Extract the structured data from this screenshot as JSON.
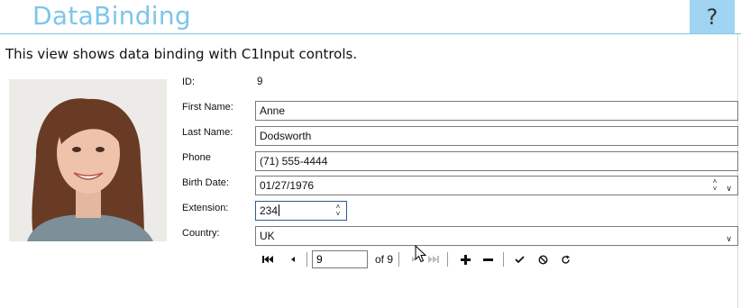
{
  "header": {
    "title": "DataBinding",
    "help_label": "?"
  },
  "description": "This view shows data binding with C1Input controls.",
  "form": {
    "id_label": "ID:",
    "id_value": "9",
    "first_name_label": "First Name:",
    "first_name_value": "Anne",
    "last_name_label": "Last Name:",
    "last_name_value": "Dodsworth",
    "phone_label": "Phone",
    "phone_value": "(71) 555-4444",
    "birth_date_label": "Birth Date:",
    "birth_date_value": "01/27/1976",
    "extension_label": "Extension:",
    "extension_value": "234",
    "country_label": "Country:",
    "country_value": "UK"
  },
  "navigator": {
    "current_page": "9",
    "total_label": "of 9"
  },
  "icons": {
    "first": "first-record-icon",
    "prev": "previous-record-icon",
    "next": "next-record-icon",
    "last": "last-record-icon",
    "add": "plus-icon",
    "delete": "minus-icon",
    "save": "checkmark-icon",
    "cancel": "cancel-icon",
    "refresh": "refresh-icon",
    "help": "question-icon"
  },
  "colors": {
    "title": "#7cc6ea",
    "help_bg": "#9fd4f2",
    "header_rule": "#7fc3e6",
    "focus_border": "#2c5c94"
  }
}
